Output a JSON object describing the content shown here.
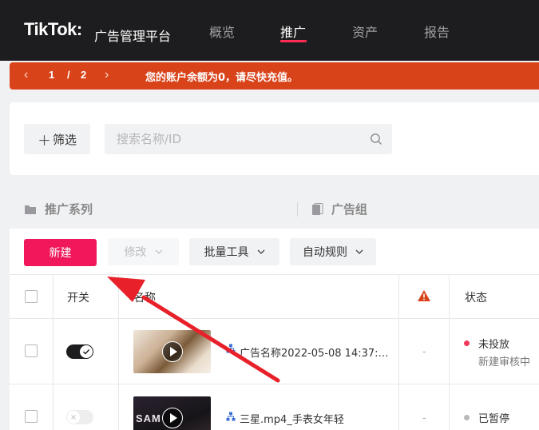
{
  "brand": {
    "logo": "TikTok",
    "colon": ":",
    "subtitle": "广告管理平台"
  },
  "nav": [
    "概览",
    "推广",
    "资产",
    "报告"
  ],
  "nav_active": "推广",
  "notice": {
    "current": "1",
    "slash": "/",
    "total": "2",
    "message": "您的账户余额为0，请尽快充值。"
  },
  "filter": {
    "button": "筛选",
    "search_placeholder": "搜索名称/ID"
  },
  "tabs": [
    "推广系列",
    "广告组"
  ],
  "toolbar": {
    "new": "新建",
    "edit": "修改",
    "bulk": "批量工具",
    "rules": "自动规则"
  },
  "table": {
    "headers": {
      "toggle": "开关",
      "name": "名称",
      "status": "状态"
    },
    "rows": [
      {
        "name": "广告名称2022-05-08 14:37:…",
        "metric": "-",
        "status": "未投放",
        "status_sub": "新建审核中",
        "toggle": "on",
        "status_color": "#f0375a"
      },
      {
        "name": "三星.mp4_手表女年轻",
        "metric": "-",
        "status": "已暂停",
        "status_sub": "",
        "toggle": "off",
        "status_color": "#b8b8bb",
        "thumb_text": "SAM"
      }
    ]
  },
  "colors": {
    "accent": "#f0175a",
    "notice": "#d9431a",
    "nav_bg": "#1d1d1f",
    "annotation": "#e8202a"
  }
}
